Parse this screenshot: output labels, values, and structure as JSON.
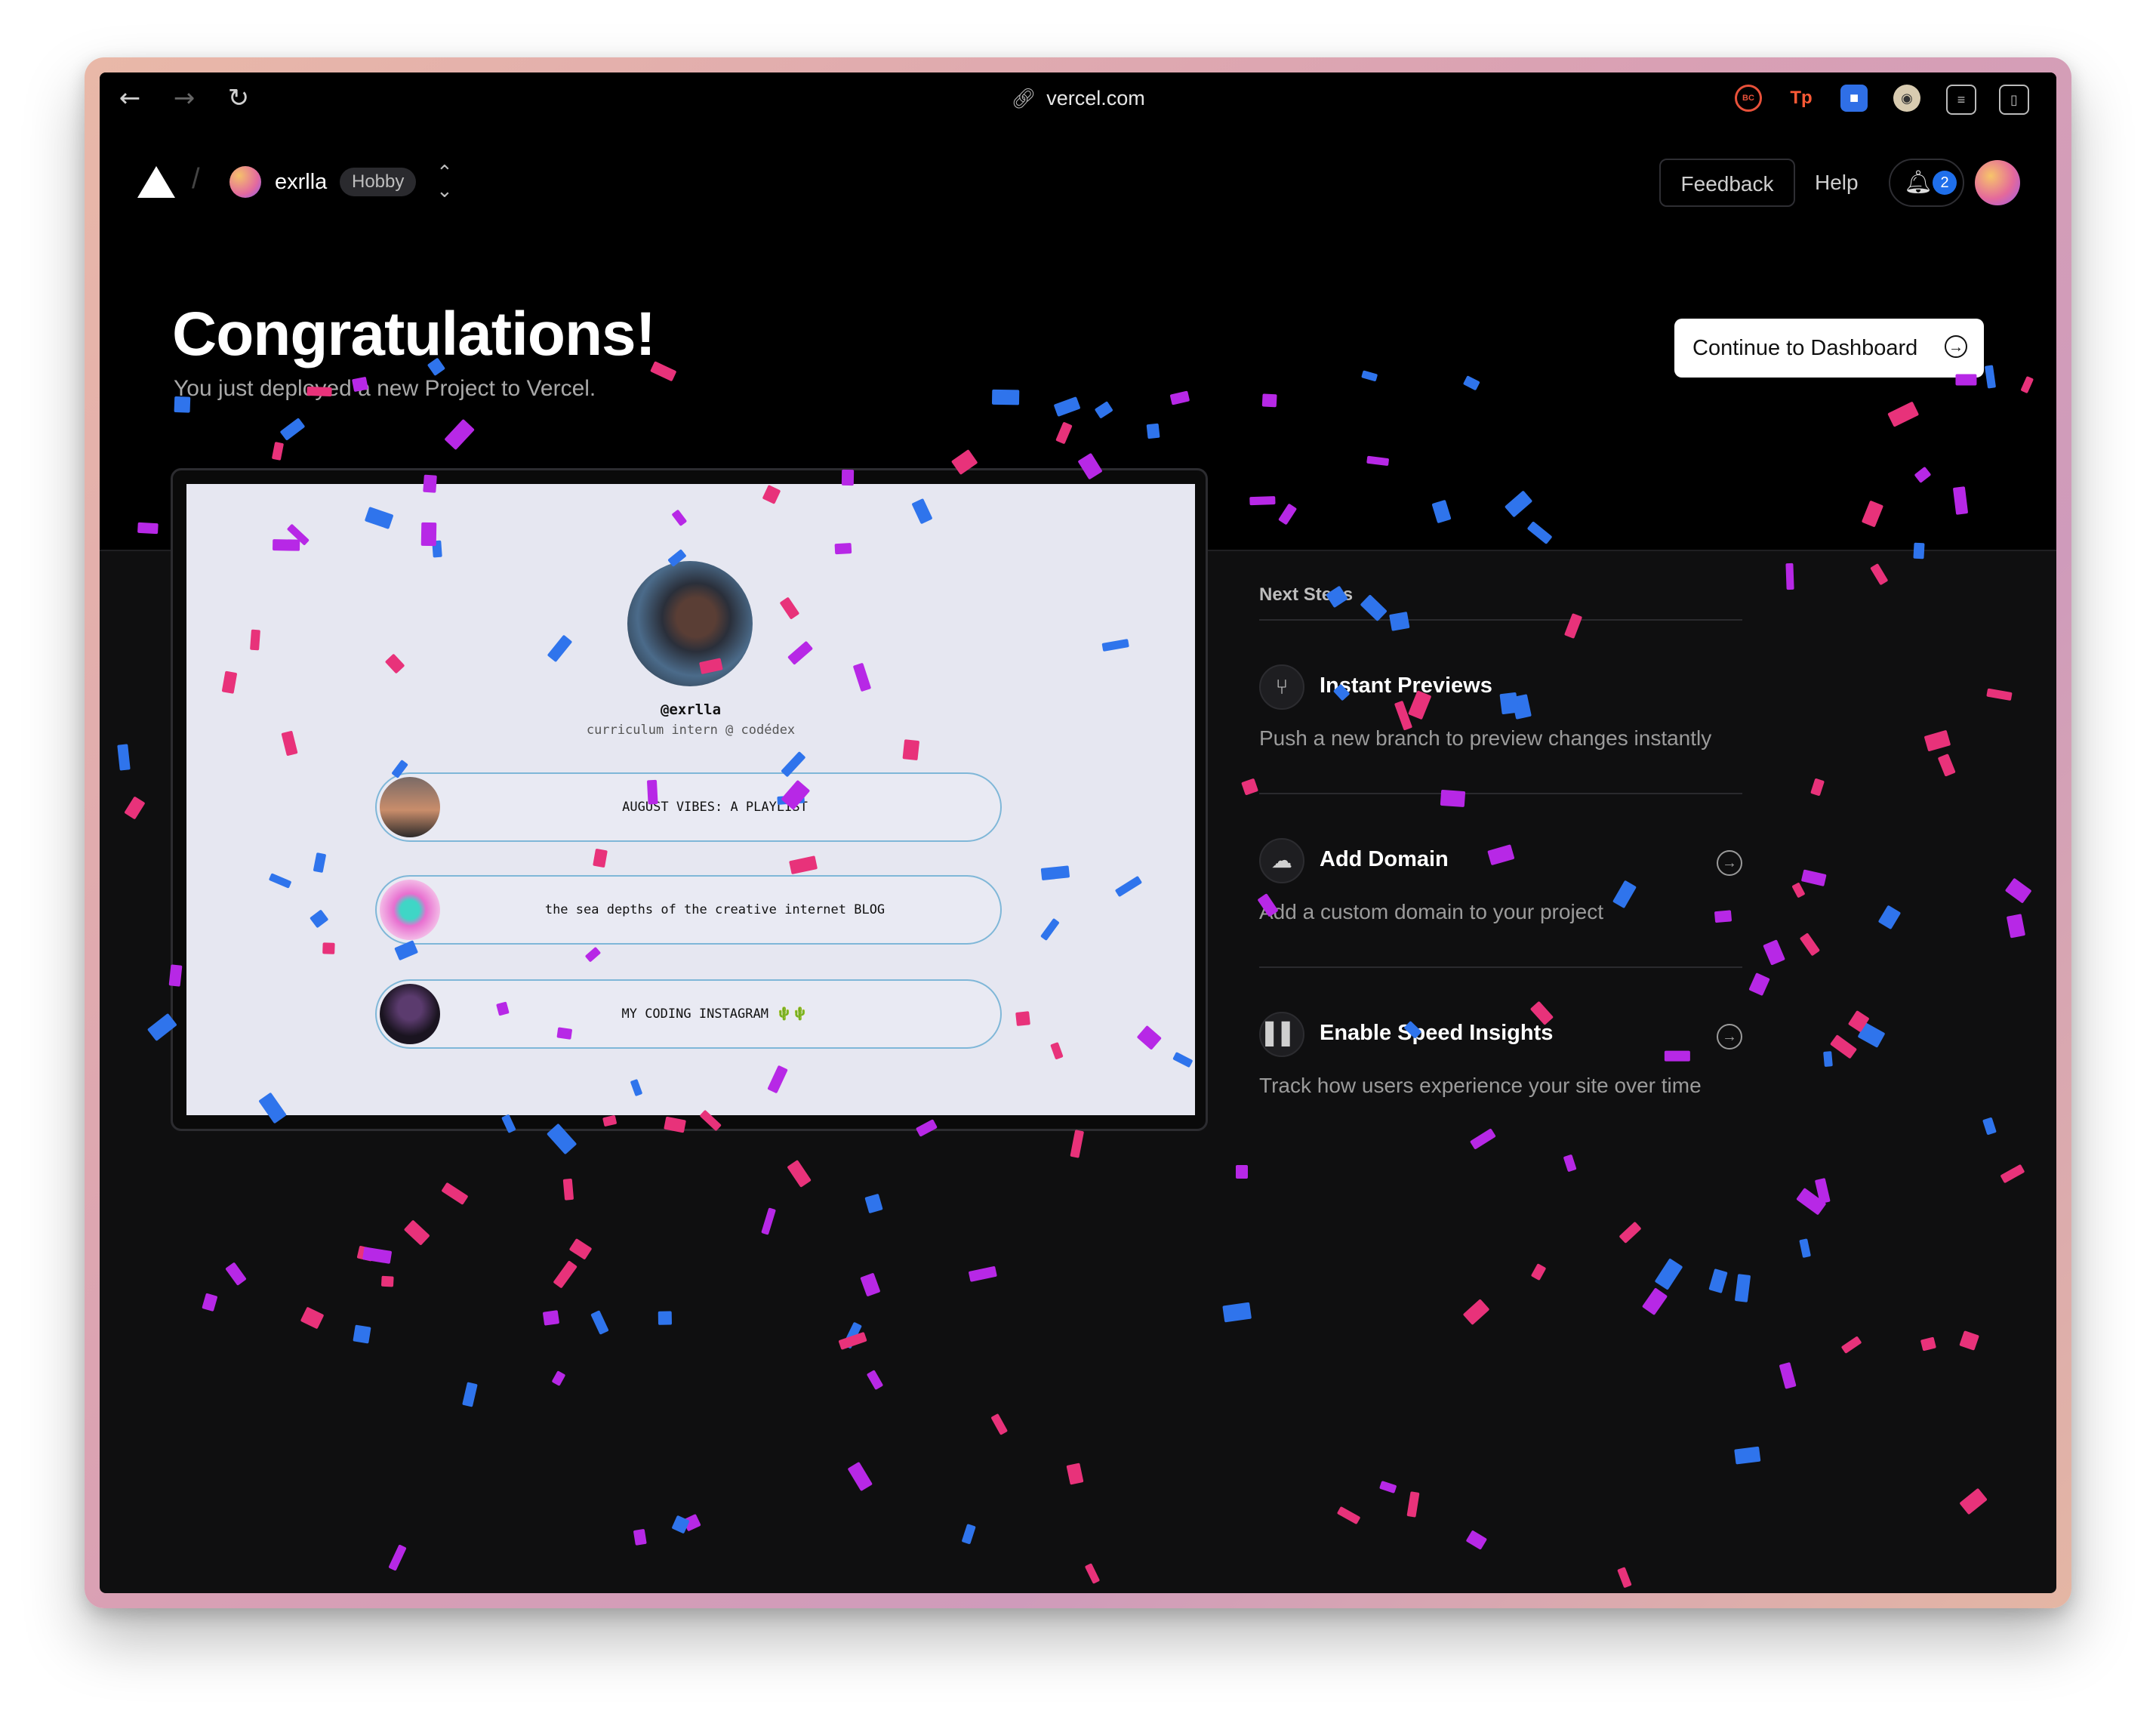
{
  "browser": {
    "url": "vercel.com",
    "back_icon": "arrow-left-icon",
    "forward_icon": "arrow-right-icon",
    "reload_icon": "reload-icon"
  },
  "header": {
    "team_name": "exrlla",
    "plan_badge": "Hobby",
    "feedback_label": "Feedback",
    "help_label": "Help",
    "notification_count": "2"
  },
  "hero": {
    "title": "Congratulations!",
    "subtitle": "You just deployed a new Project to Vercel.",
    "cta_label": "Continue to Dashboard"
  },
  "preview": {
    "handle": "@exrlla",
    "bio": "curriculum intern @ codédex",
    "links": [
      {
        "label": "AUGUST VIBES: A PLAYLIST"
      },
      {
        "label": "the sea depths of the creative internet BLOG"
      },
      {
        "label": "MY CODING INSTAGRAM 🌵🌵"
      }
    ]
  },
  "next_steps": {
    "title": "Next Steps",
    "items": [
      {
        "name": "Instant Previews",
        "description": "Push a new branch to preview changes instantly",
        "icon": "git-branch-icon"
      },
      {
        "name": "Add Domain",
        "description": "Add a custom domain to your project",
        "icon": "cloud-icon"
      },
      {
        "name": "Enable Speed Insights",
        "description": "Track how users experience your site over time",
        "icon": "bar-chart-icon"
      }
    ]
  },
  "colors": {
    "confetti": [
      "#e8327a",
      "#b728e6",
      "#2f74ec"
    ],
    "accent": "#1f6feb"
  }
}
